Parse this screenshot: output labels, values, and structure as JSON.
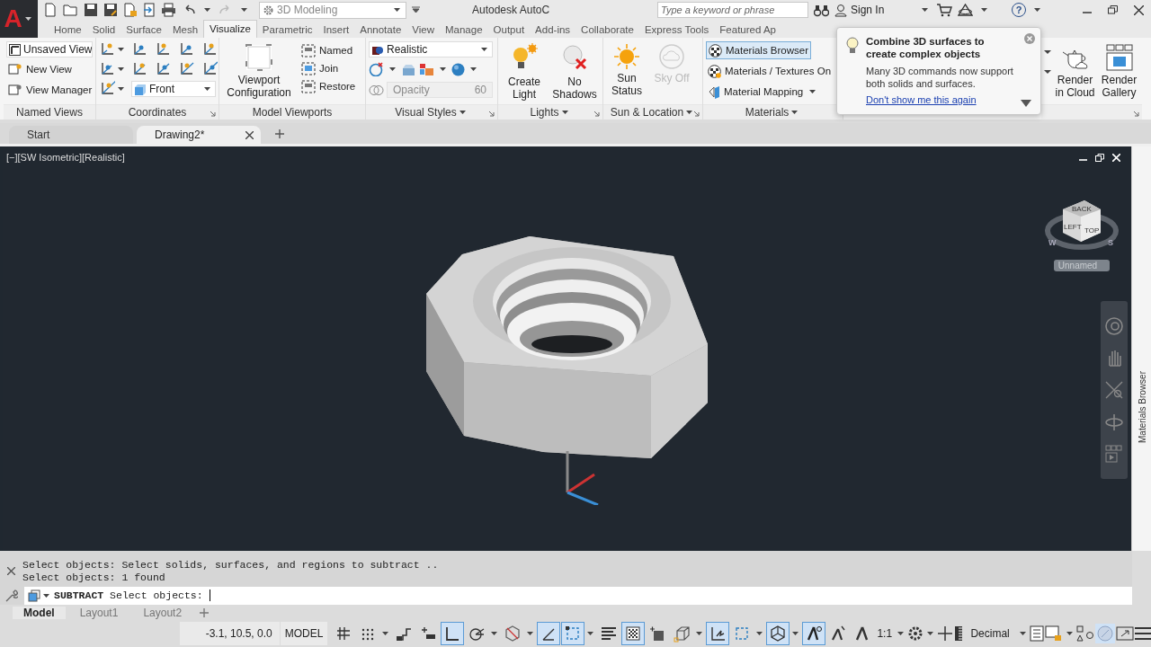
{
  "title_bar": {
    "app_button": "A",
    "workspace": "3D Modeling",
    "title": "Autodesk AutoC",
    "search": {
      "placeholder": "Type a keyword or phrase"
    },
    "sign_in": "Sign In",
    "help": "?"
  },
  "ribbon_tabs": [
    {
      "label": "Home",
      "selected": false
    },
    {
      "label": "Solid",
      "selected": false
    },
    {
      "label": "Surface",
      "selected": false
    },
    {
      "label": "Mesh",
      "selected": false
    },
    {
      "label": "Visualize",
      "selected": true
    },
    {
      "label": "Parametric",
      "selected": false
    },
    {
      "label": "Insert",
      "selected": false
    },
    {
      "label": "Annotate",
      "selected": false
    },
    {
      "label": "View",
      "selected": false
    },
    {
      "label": "Manage",
      "selected": false
    },
    {
      "label": "Output",
      "selected": false
    },
    {
      "label": "Add-ins",
      "selected": false
    },
    {
      "label": "Collaborate",
      "selected": false
    },
    {
      "label": "Express Tools",
      "selected": false
    },
    {
      "label": "Featured Ap",
      "selected": false
    }
  ],
  "panels": [
    {
      "kind": "named_views",
      "title": "Named Views",
      "dropdown": "Unsaved View",
      "buttons": [
        "New View",
        "View Manager"
      ]
    },
    {
      "kind": "coordinates",
      "title": "Coordinates",
      "view_dropdown": "Front"
    },
    {
      "kind": "viewports",
      "title": "Model Viewports",
      "large": "Viewport Configuration",
      "buttons": [
        "Named",
        "Join",
        "Restore"
      ]
    },
    {
      "kind": "visual_styles",
      "title": "Visual Styles",
      "style": "Realistic",
      "opacity": {
        "placeholder": "Opacity",
        "value": "60",
        "disabled": true
      }
    },
    {
      "kind": "lights",
      "title": "Lights",
      "buttons": [
        "Create Light",
        "No Shadows"
      ]
    },
    {
      "kind": "sun",
      "title": "Sun & Location",
      "buttons": [
        {
          "label": "Sun Status",
          "disabled": false
        },
        {
          "label": "Sky Off",
          "disabled": true
        }
      ]
    },
    {
      "kind": "materials",
      "title": "Materials",
      "buttons": [
        {
          "label": "Materials Browser",
          "selected": true
        },
        {
          "label": "Materials / Textures On",
          "selected": false
        },
        {
          "label": "Material Mapping",
          "selected": false
        }
      ]
    },
    {
      "kind": "covered"
    },
    {
      "kind": "render",
      "buttons": [
        "Render in Cloud",
        "Render Gallery"
      ]
    }
  ],
  "tooltip": {
    "title": "Combine 3D surfaces to create complex objects",
    "body": "Many 3D commands now support both solids and surfaces.",
    "link": "Don't show me this again"
  },
  "document_tabs": [
    {
      "label": "Start",
      "selected": false
    },
    {
      "label": "Drawing2*",
      "selected": true
    }
  ],
  "viewport": {
    "label": "[−][SW Isometric][Realistic]",
    "cube_faces": [
      "BACK",
      "LEFT",
      "TOP"
    ],
    "compass": [
      "W",
      "S"
    ],
    "ucs_name": "Unnamed"
  },
  "palette": {
    "title": "Materials Browser"
  },
  "command_line": {
    "history": [
      "Select objects:  Select solids, surfaces, and regions to subtract ..",
      "Select objects: 1 found"
    ],
    "prompt": "**SUBTRACT** Select objects:"
  },
  "layout_tabs": [
    {
      "label": "Model",
      "selected": true
    },
    {
      "label": "Layout1",
      "selected": false
    },
    {
      "label": "Layout2",
      "selected": false
    }
  ],
  "status_bar": {
    "coordinates": "-3.1, 10.5, 0.0",
    "space": "MODEL",
    "scale": "1:1",
    "units": "Decimal",
    "toggles": [
      {
        "kind": "grid",
        "on": false,
        "dropdown": false
      },
      {
        "kind": "snap",
        "on": false,
        "dropdown": true
      },
      {
        "kind": "infer",
        "on": false,
        "dropdown": false
      },
      {
        "kind": "dyn",
        "on": false,
        "dropdown": false
      },
      {
        "kind": "ortho",
        "on": true,
        "dropdown": false
      },
      {
        "kind": "polar",
        "on": false,
        "dropdown": true
      },
      {
        "kind": "iso",
        "on": false,
        "dropdown": true
      },
      {
        "kind": "otrack",
        "on": true,
        "dropdown": false
      },
      {
        "kind": "osnap",
        "on": true,
        "dropdown": true
      },
      {
        "kind": "lineweight",
        "on": false,
        "dropdown": false
      },
      {
        "kind": "transparency",
        "on": true,
        "dropdown": false
      },
      {
        "kind": "cycling",
        "on": false,
        "dropdown": false
      },
      {
        "kind": "osnap3d",
        "on": false,
        "dropdown": true
      },
      {
        "kind": "ducs",
        "on": true,
        "dropdown": false
      },
      {
        "kind": "filter",
        "on": false,
        "dropdown": true
      },
      {
        "kind": "gizmo",
        "on": true,
        "dropdown": true
      },
      {
        "kind": "annovis",
        "on": true,
        "dropdown": false
      },
      {
        "kind": "autoscale",
        "on": false,
        "dropdown": false
      },
      {
        "kind": "annoscale",
        "on": false,
        "dropdown": false
      }
    ]
  }
}
